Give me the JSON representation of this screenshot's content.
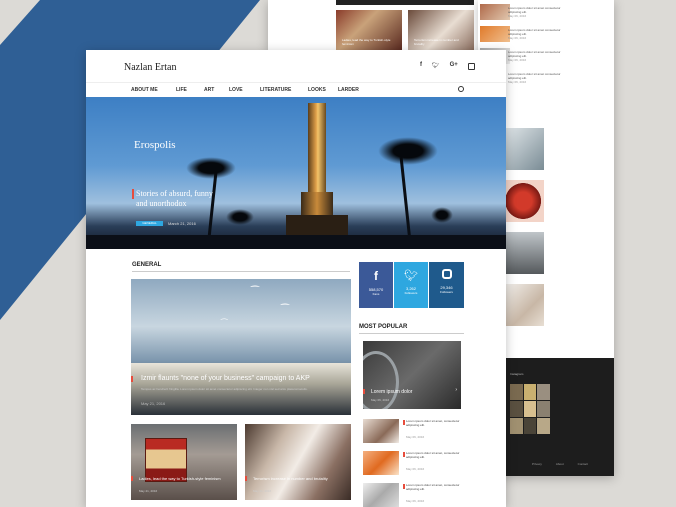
{
  "colors": {
    "accent": "#e74c3c",
    "facebook": "#3b5998",
    "twitter": "#2ea7e0",
    "instagram": "#1f5a8c",
    "blue_shape": "#2f5f95"
  },
  "site": {
    "title": "Nazlan Ertan"
  },
  "social_icons": [
    "facebook-icon",
    "twitter-icon",
    "google-plus-icon",
    "instagram-icon"
  ],
  "nav": [
    "ABOUT ME",
    "LIFE",
    "ART",
    "LOVE",
    "LITERATURE",
    "LOOKS",
    "LARDER"
  ],
  "hero": {
    "title": "Erospolis",
    "caption": "Stories of absurd, funny and unorthodox",
    "tag": "GENERAL",
    "date": "March 21, 2016"
  },
  "general": {
    "heading": "GENERAL",
    "feature": {
      "title": "Izmir flaunts \"none of your business\" campaign to AKP",
      "excerpt": "Tempus ac hendrerit fringilla. Lorem ipsum dolor sit amet consectetur adipiscing elit. Integer non nisl sed arcu placerat iaculis.",
      "date": "May 21, 2016"
    },
    "cards": [
      {
        "title": "Ladies, lead the way to Turkish-style feminism",
        "date": "May 21, 2016"
      },
      {
        "title": "Terrorism increase in number and brutality",
        "date": "May 21, 2016"
      }
    ]
  },
  "social": [
    {
      "count": "558,570",
      "label": "Fans",
      "icon": "facebook-icon"
    },
    {
      "count": "3,262",
      "label": "Followers",
      "icon": "twitter-icon"
    },
    {
      "count": "29,346",
      "label": "Followers",
      "icon": "instagram-icon"
    }
  ],
  "popular": {
    "heading": "MOST POPULAR",
    "top": {
      "title": "Lorem ipsum dolor",
      "date": "May 06, 2016"
    },
    "items": [
      {
        "title": "Lorem ipsum dolor sit amet, consectetur adipiscing elit.",
        "date": "May 06, 2016"
      },
      {
        "title": "Lorem ipsum dolor sit amet, consectetur adipiscing elit.",
        "date": "May 06, 2016"
      },
      {
        "title": "Lorem ipsum dolor sit amet, consectetur adipiscing elit.",
        "date": "May 06, 2016"
      }
    ]
  },
  "back_right": {
    "items": [
      {
        "title": "Lorem ipsum dolor sit amet consectetur adipiscing elit.",
        "date": "May 06, 2016"
      },
      {
        "title": "Lorem ipsum dolor sit amet consectetur adipiscing elit.",
        "date": "May 06, 2016"
      },
      {
        "title": "Lorem ipsum dolor sit amet consectetur adipiscing elit.",
        "date": "May 06, 2016"
      },
      {
        "title": "Lorem ipsum dolor sit amet consectetur adipiscing elit.",
        "date": "May 06, 2016"
      },
      {
        "title": "Lorem ipsum dolor sit amet consectetur adipiscing elit.",
        "date": "May 06, 2016"
      }
    ],
    "footer_heading": "Instagram",
    "footer_links": [
      "Privacy",
      "About",
      "Contact"
    ]
  }
}
